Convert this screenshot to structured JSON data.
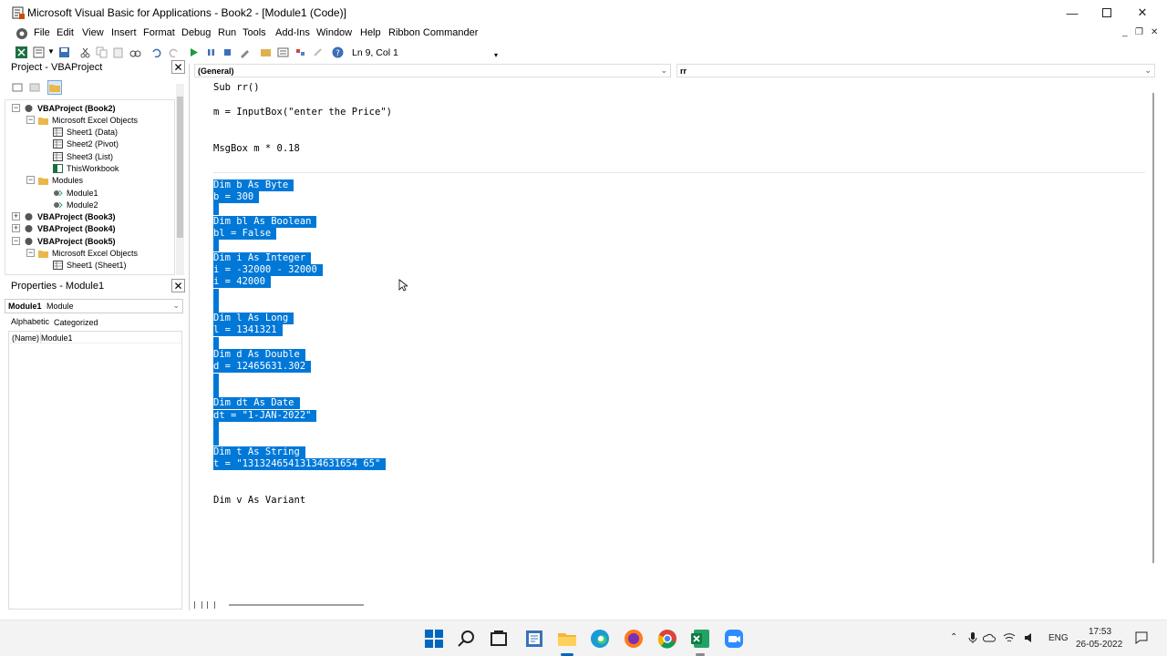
{
  "window": {
    "title": "Microsoft Visual Basic for Applications - Book2 - [Module1 (Code)]"
  },
  "menu": {
    "items": [
      "File",
      "Edit",
      "View",
      "Insert",
      "Format",
      "Debug",
      "Run",
      "Tools",
      "Add-Ins",
      "Window",
      "Help",
      "Ribbon Commander"
    ]
  },
  "toolbar": {
    "position": "Ln 9, Col 1"
  },
  "project_pane": {
    "title": "Project - VBAProject",
    "nodes": [
      "VBAProject (Book2)",
      "Microsoft Excel Objects",
      "Sheet1 (Data)",
      "Sheet2 (Pivot)",
      "Sheet3 (List)",
      "ThisWorkbook",
      "Modules",
      "Module1",
      "Module2",
      "VBAProject (Book3)",
      "VBAProject (Book4)",
      "VBAProject (Book5)",
      "Microsoft Excel Objects",
      "Sheet1 (Sheet1)"
    ]
  },
  "properties_pane": {
    "title": "Properties - Module1",
    "object_name": "Module1",
    "object_type": "Module",
    "tabs": [
      "Alphabetic",
      "Categorized"
    ],
    "row_name_label": "(Name)",
    "row_name_value": "Module1"
  },
  "code_window": {
    "object_combo": "(General)",
    "procedure_combo": "rr",
    "lines": [
      "Sub rr()",
      "m = InputBox(\"enter the Price\")",
      "MsgBox m * 0.18",
      "Dim b As Byte",
      "b = 300",
      "Dim bl As Boolean",
      "bl = False",
      "Dim i As Integer",
      "i = -32000 - 32000",
      "i = 42000",
      "Dim l As Long",
      "l = 1341321",
      "Dim d As Double",
      "d = 12465631.302",
      "Dim dt As Date",
      "dt = \"1-JAN-2022\"",
      "Dim t As String",
      "t = \"13132465413134631654 65\"",
      "Dim v As Variant"
    ]
  },
  "taskbar": {
    "language": "ENG",
    "time": "17:53",
    "date": "26-05-2022"
  },
  "colors": {
    "selection": "#0078d7",
    "excel_green": "#1d6f42",
    "windows_blue": "#0067c0"
  }
}
